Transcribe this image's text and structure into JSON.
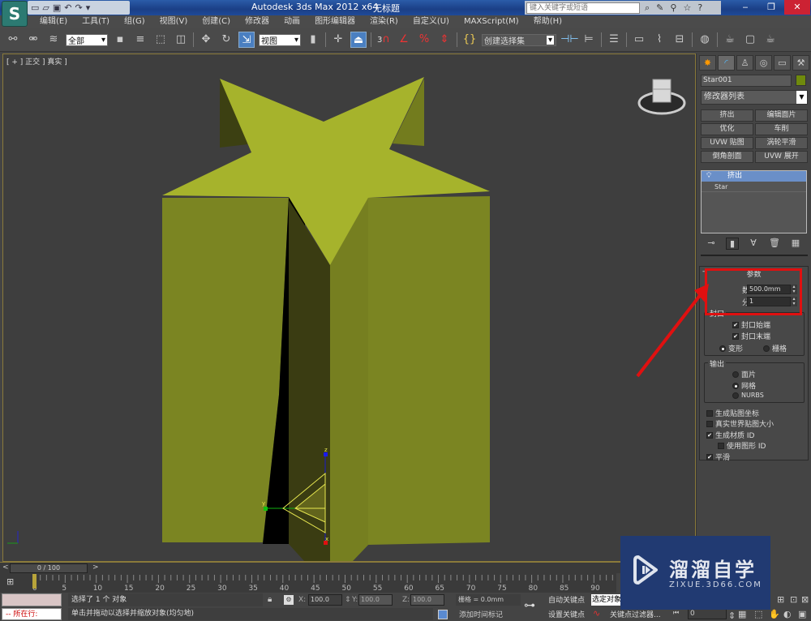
{
  "titlebar": {
    "app_title": "Autodesk 3ds Max  2012 x64",
    "doc_title": "无标题",
    "search_placeholder": "键入关键字或短语",
    "logo_icon": "3dsmax-logo-icon",
    "qat_icons": [
      "new-file-icon",
      "open-folder-icon",
      "save-icon",
      "undo-icon",
      "redo-icon",
      "customize-dropdown-icon"
    ],
    "search_icons": [
      "binoculars-icon",
      "wrench-icon",
      "satellite-icon",
      "star-icon",
      "help-icon"
    ],
    "window_controls": {
      "minimize": "‒",
      "restore": "❐",
      "close": "✕"
    }
  },
  "menubar": [
    "编辑(E)",
    "工具(T)",
    "组(G)",
    "视图(V)",
    "创建(C)",
    "修改器",
    "动画",
    "图形编辑器",
    "渲染(R)",
    "自定义(U)",
    "MAXScript(M)",
    "帮助(H)"
  ],
  "toolbar": {
    "selection_filter": "全部",
    "ref_coord": "视图",
    "named_selection": "创建选择集",
    "snap_label": "3"
  },
  "viewport": {
    "label": "[ + ] 正交 ] 真实 ]",
    "axis_labels": {
      "z": "z",
      "y": "y",
      "x": "x"
    }
  },
  "command_panel": {
    "tabs": [
      "create-icon",
      "modify-icon",
      "hierarchy-icon",
      "motion-icon",
      "display-icon",
      "utilities-icon"
    ],
    "object_name": "Star001",
    "object_color": "#6f8a0d",
    "modifier_list": "修改器列表",
    "modifier_buttons": [
      "挤出",
      "编辑面片",
      "优化",
      "车削",
      "UVW 贴图",
      "涡轮平滑",
      "倒角剖面",
      "UVW 展开"
    ],
    "stack": {
      "selected": "挤出",
      "base": "Star"
    },
    "parameters": {
      "title": "参数",
      "amount_label": "数量:",
      "amount_value": "500.0mm",
      "segments_label": "分段:",
      "segments_value": "1",
      "capping_group": "封口",
      "cap_start": {
        "label": "封口始端",
        "checked": true
      },
      "cap_end": {
        "label": "封口末端",
        "checked": true
      },
      "morph": {
        "label": "变形",
        "selected": true
      },
      "grid": {
        "label": "栅格",
        "selected": false
      },
      "output_group": "输出",
      "output_patch": {
        "label": "面片",
        "selected": false
      },
      "output_mesh": {
        "label": "网格",
        "selected": true
      },
      "output_nurbs": {
        "label": "NURBS",
        "selected": false
      },
      "gen_mapping": {
        "label": "生成贴图坐标",
        "checked": false
      },
      "real_world": {
        "label": "真实世界贴图大小",
        "checked": false
      },
      "gen_matid": {
        "label": "生成材质 ID",
        "checked": true
      },
      "use_shape_ids": {
        "label": "使用图形 ID",
        "checked": false
      },
      "smooth": {
        "label": "平滑",
        "checked": true
      }
    }
  },
  "timeline": {
    "slider_label": "0 / 100",
    "prev": "<",
    "next": ">",
    "ticks": [
      "0",
      "5",
      "10",
      "15",
      "20",
      "25",
      "30",
      "35",
      "40",
      "45",
      "50",
      "55",
      "60",
      "65",
      "70",
      "75",
      "80",
      "85",
      "90"
    ]
  },
  "status": {
    "maxscript_line": "-- 所在行:",
    "selection": "选择了 1 个 对象",
    "prompt": "单击并拖动以选择并缩放对象(均匀地)",
    "x_label": "X:",
    "x_value": "100.0",
    "y_label": "Y:",
    "y_value": "100.0",
    "z_label": "Z:",
    "z_value": "100.0",
    "grid": "栅格 = 0.0mm",
    "add_time_tag": "添加时间标记",
    "auto_key": "自动关键点",
    "set_key": "设置关键点",
    "key_mode": "选定对象",
    "key_filters": "关键点过滤器...",
    "frame": "0"
  },
  "watermark": {
    "title": "溜溜自学",
    "url": "ZIXUE.3D66.COM"
  },
  "colors": {
    "star_top": "#a6b32c",
    "star_side": "#7b8522",
    "star_dark": "#3a3c12",
    "annotation_red": "#e01010"
  }
}
